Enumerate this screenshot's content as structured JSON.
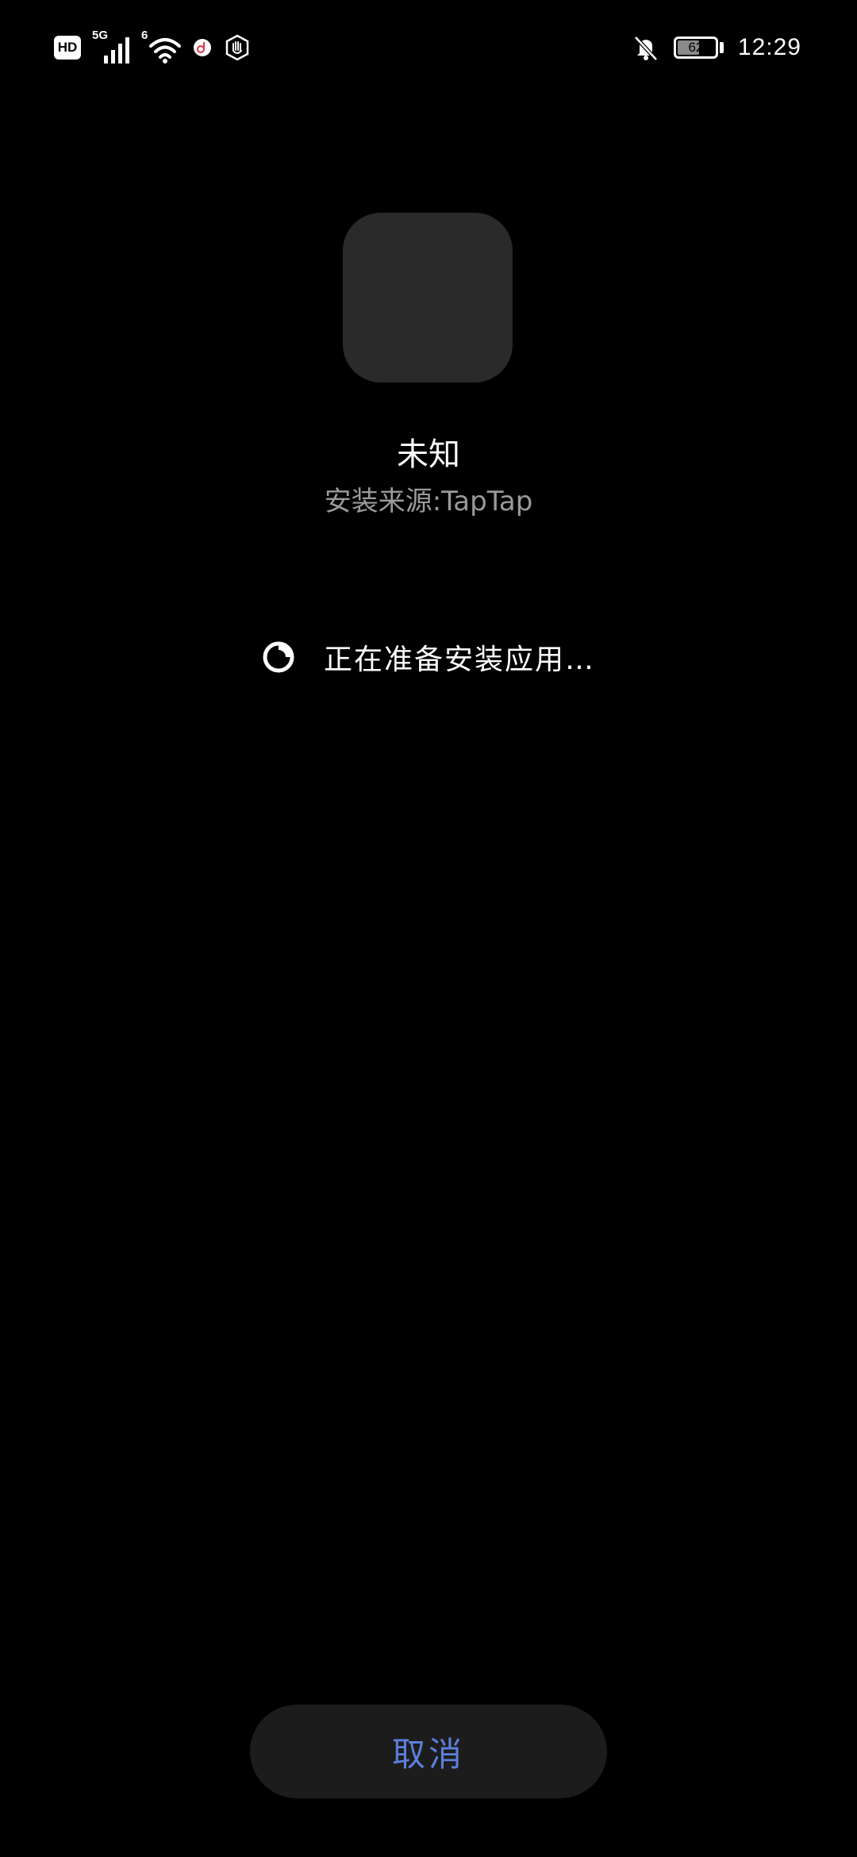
{
  "status_bar": {
    "hd_label": "HD",
    "signal_label": "5G",
    "wifi_label": "6",
    "battery_level": "62",
    "battery_fraction": 0.62,
    "time": "12:29",
    "icons": [
      "hd-icon",
      "cellular-signal-icon",
      "wifi-icon",
      "app-notification-icon",
      "hand-shield-icon",
      "notifications-muted-icon",
      "battery-icon"
    ]
  },
  "app": {
    "name": "未知",
    "install_source": "安装来源:TapTap"
  },
  "progress": {
    "message": "正在准备安装应用…"
  },
  "actions": {
    "cancel_label": "取消"
  },
  "colors": {
    "background": "#000000",
    "icon_placeholder": "#2a2a2a",
    "button_background": "#1c1c1c",
    "accent": "#5c7fdc",
    "secondary_text": "#9a9a9a"
  }
}
